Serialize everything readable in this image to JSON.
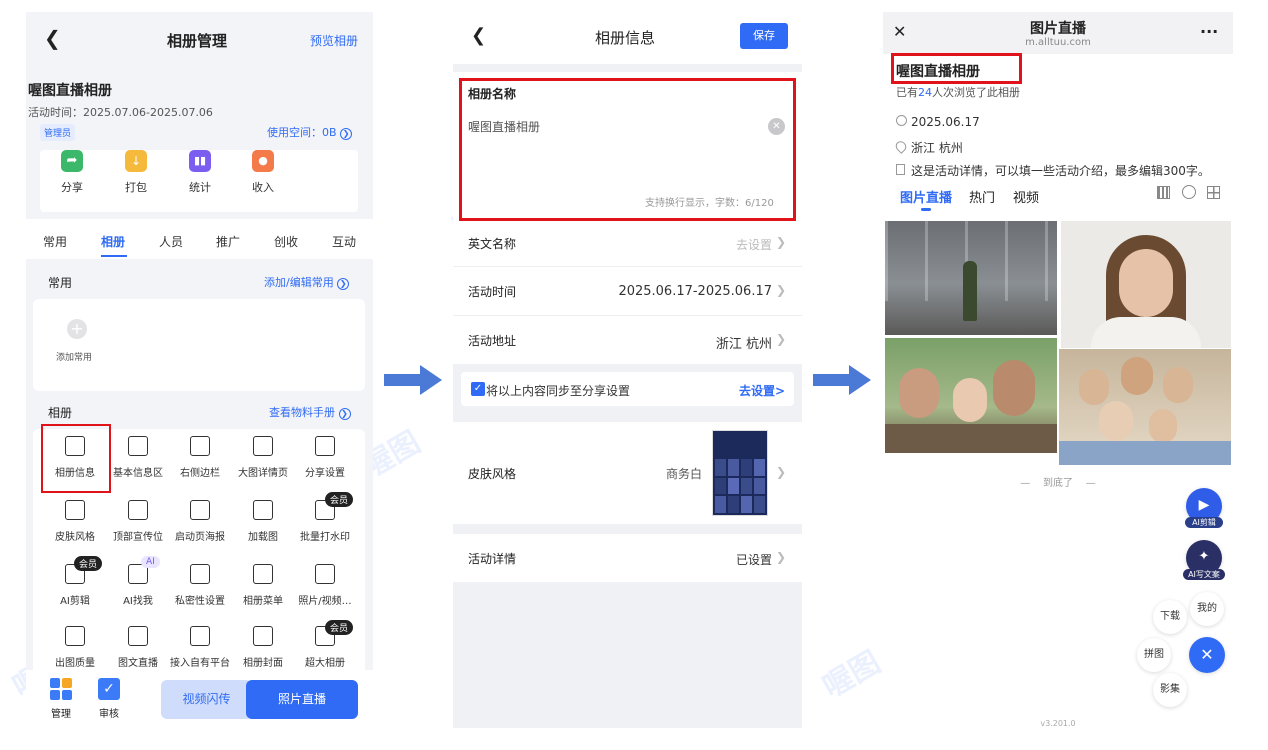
{
  "panel1": {
    "header": {
      "title": "相册管理",
      "preview": "预览相册"
    },
    "album": {
      "name": "喔图直播相册",
      "time": "活动时间：2025.07.06-2025.07.06",
      "role": "管理员",
      "space": "使用空间：0B"
    },
    "quick": [
      {
        "label": "分享",
        "color": "#3bb86a"
      },
      {
        "label": "打包",
        "color": "#f5b93b"
      },
      {
        "label": "统计",
        "color": "#7b5df0"
      },
      {
        "label": "收入",
        "color": "#f57a4a"
      }
    ],
    "tabs": [
      "常用",
      "相册",
      "人员",
      "推广",
      "创收",
      "互动"
    ],
    "common": {
      "title": "常用",
      "action": "添加/编辑常用",
      "add": "添加常用"
    },
    "album_section": {
      "title": "相册",
      "action": "查看物料手册"
    },
    "grid": [
      "相册信息",
      "基本信息区",
      "右侧边栏",
      "大图详情页",
      "分享设置",
      "皮肤风格",
      "顶部宣传位",
      "启动页海报",
      "加载图",
      "批量打水印",
      "AI剪辑",
      "AI找我",
      "私密性设置",
      "相册菜单",
      "照片/视频…",
      "出图质量",
      "图文直播",
      "接入自有平台",
      "相册封面",
      "超大相册"
    ],
    "badges": {
      "member": "会员",
      "ai": "AI"
    },
    "bottom": {
      "manage": "管理",
      "review": "审核",
      "video": "视频闪传",
      "live": "照片直播"
    }
  },
  "panel2": {
    "header": {
      "title": "相册信息",
      "save": "保存"
    },
    "name_field": {
      "label": "相册名称",
      "value": "喔图直播相册",
      "hint": "支持换行显示，字数：6/120"
    },
    "rows": {
      "english": {
        "label": "英文名称",
        "value": "去设置"
      },
      "time": {
        "label": "活动时间",
        "value": "2025.06.17-2025.06.17"
      },
      "address": {
        "label": "活动地址",
        "value": "浙江 杭州"
      }
    },
    "sync": {
      "label": "将以上内容同步至分享设置",
      "action": "去设置>"
    },
    "skin": {
      "label": "皮肤风格",
      "value": "商务白"
    },
    "detail": {
      "label": "活动详情",
      "value": "已设置"
    }
  },
  "panel3": {
    "header": {
      "title": "图片直播",
      "url": "m.alltuu.com",
      "more": "···"
    },
    "album_name": "喔图直播相册",
    "views_pre": "已有",
    "views_num": "24",
    "views_post": "人次浏览了此相册",
    "date": "2025.06.17",
    "location": "浙江 杭州",
    "intro": "这是活动详情，可以填一些活动介绍，最多编辑300字。",
    "tabs": [
      "图片直播",
      "热门",
      "视频"
    ],
    "end": "—    到底了    —",
    "floating": {
      "ai_edit": "AI剪辑",
      "ai_copy": "AI写文案",
      "download": "下载",
      "mine": "我的",
      "collage": "拼图",
      "video": "影集"
    },
    "version": "v3.201.0"
  },
  "colors": {
    "accent": "#2f6bf4",
    "highlight": "#e0121a"
  }
}
